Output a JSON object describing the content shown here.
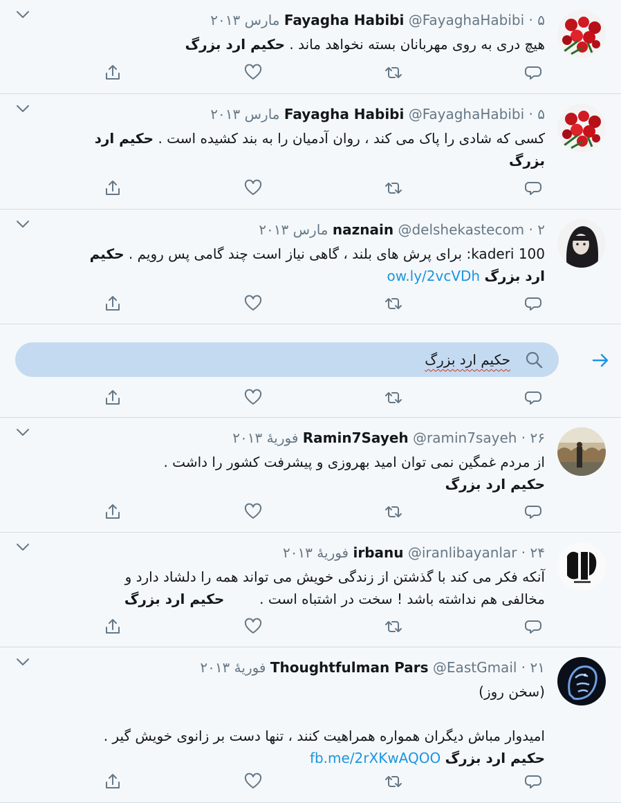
{
  "colors": {
    "background": "#f5f8fa",
    "text": "#14171a",
    "muted": "#657786",
    "link": "#1b95e0",
    "icon": "#657786",
    "search_fill": "#c4daf0"
  },
  "search": {
    "query": "حکیم ارد بزرگ",
    "icon": "search-icon",
    "submit_icon": "arrow-right-icon"
  },
  "tweets": [
    {
      "fullname": "Fayagha Habibi",
      "handle": "@FayaghaHabibi",
      "dot": "·",
      "time": "۵ مارس ۲۰۱۳",
      "lines": [
        {
          "text": "هیچ دری به روی مهربانان بسته نخواهد ماند .",
          "bold": "حکیم ارد بزرگ"
        }
      ]
    },
    {
      "fullname": "Fayagha Habibi",
      "handle": "@FayaghaHabibi",
      "dot": "·",
      "time": "۵ مارس ۲۰۱۳",
      "lines": [
        {
          "text": "کسی که شادی را پاک می کند ، روان آدمیان را به بند کشیده است .",
          "bold": "حکیم ارد"
        },
        {
          "text": "",
          "bold": "بزرگ"
        }
      ]
    },
    {
      "fullname": "naznain",
      "handle": "@delshekastecom",
      "dot": "·",
      "time": "۲ مارس ۲۰۱۳",
      "lines": [
        {
          "text": "kaderi 100: برای پرش های بلند ، گاهی نیاز است چند گامی پس رویم .",
          "bold": "حکیم"
        },
        {
          "text": "",
          "bold": "ارد بزرگ",
          "link": "ow.ly/2vcVDh"
        }
      ]
    },
    {
      "fullname": "Ramin7Sayeh",
      "handle": "@ramin7sayeh",
      "dot": "·",
      "time": "۲۶ فوریهٔ ۲۰۱۳",
      "lines": [
        {
          "text": "از مردم غمگین نمی توان امید بهروزی و پیشرفت کشور را داشت .",
          "bold": ""
        },
        {
          "text": "",
          "bold": "حکیم ارد بزرگ"
        }
      ]
    },
    {
      "fullname": "irbanu",
      "handle": "@iranlibayanlar",
      "dot": "·",
      "time": "۲۴ فوریهٔ ۲۰۱۳",
      "lines": [
        {
          "text": "آنکه فکر می کند با گذشتن از زندگی خویش می تواند همه را دلشاد دارد و",
          "bold": ""
        },
        {
          "text": "مخالفی هم نداشته باشد ! سخت در اشتباه است .",
          "bold": "حکیم ارد بزرگ"
        }
      ]
    },
    {
      "fullname": "Thoughtfulman Pars",
      "handle": "@EastGmail",
      "dot": "·",
      "time": "۲۱ فوریهٔ ۲۰۱۳",
      "lines": [
        {
          "text": "(سخن روز)",
          "bold": ""
        },
        {
          "text": "",
          "bold": ""
        },
        {
          "text": "امیدوار مباش دیگران همواره همراهیت کنند ، تنها دست بر زانوی خویش گیر .",
          "bold": ""
        },
        {
          "text": "",
          "bold": "حکیم ارد بزرگ",
          "link": "fb.me/2rXKwAQOO"
        }
      ]
    }
  ],
  "icons": {
    "reply": "reply-icon",
    "retweet": "retweet-icon",
    "like": "heart-icon",
    "share": "share-icon",
    "caret": "chevron-down-icon"
  }
}
